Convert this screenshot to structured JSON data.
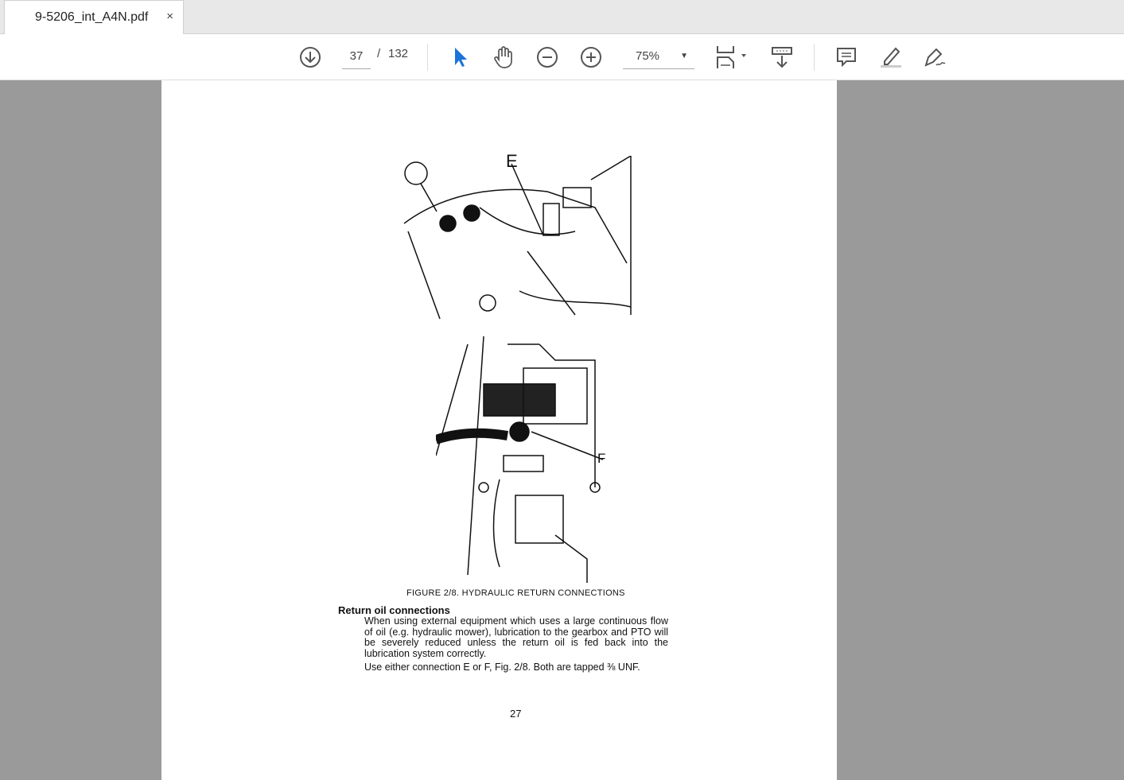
{
  "tab": {
    "title": "9-5206_int_A4N.pdf",
    "close": "×"
  },
  "toolbar": {
    "page_current": "37",
    "page_sep": "/",
    "page_total": "132",
    "zoom": "75%",
    "accent": "#1a73d9"
  },
  "document": {
    "labels": {
      "e": "E",
      "f": "F"
    },
    "caption": "FIGURE 2/8. HYDRAULIC RETURN CONNECTIONS",
    "heading": "Return oil connections",
    "para1": "When using external equipment which uses a large continuous flow of oil (e.g. hydraulic mower), lubrication to the gearbox and PTO will be severely reduced unless the return oil is fed back into the lubrication system correctly.",
    "para2": "Use either connection E or F, Fig. 2/8. Both are tapped ⅜ UNF.",
    "page_number": "27"
  }
}
